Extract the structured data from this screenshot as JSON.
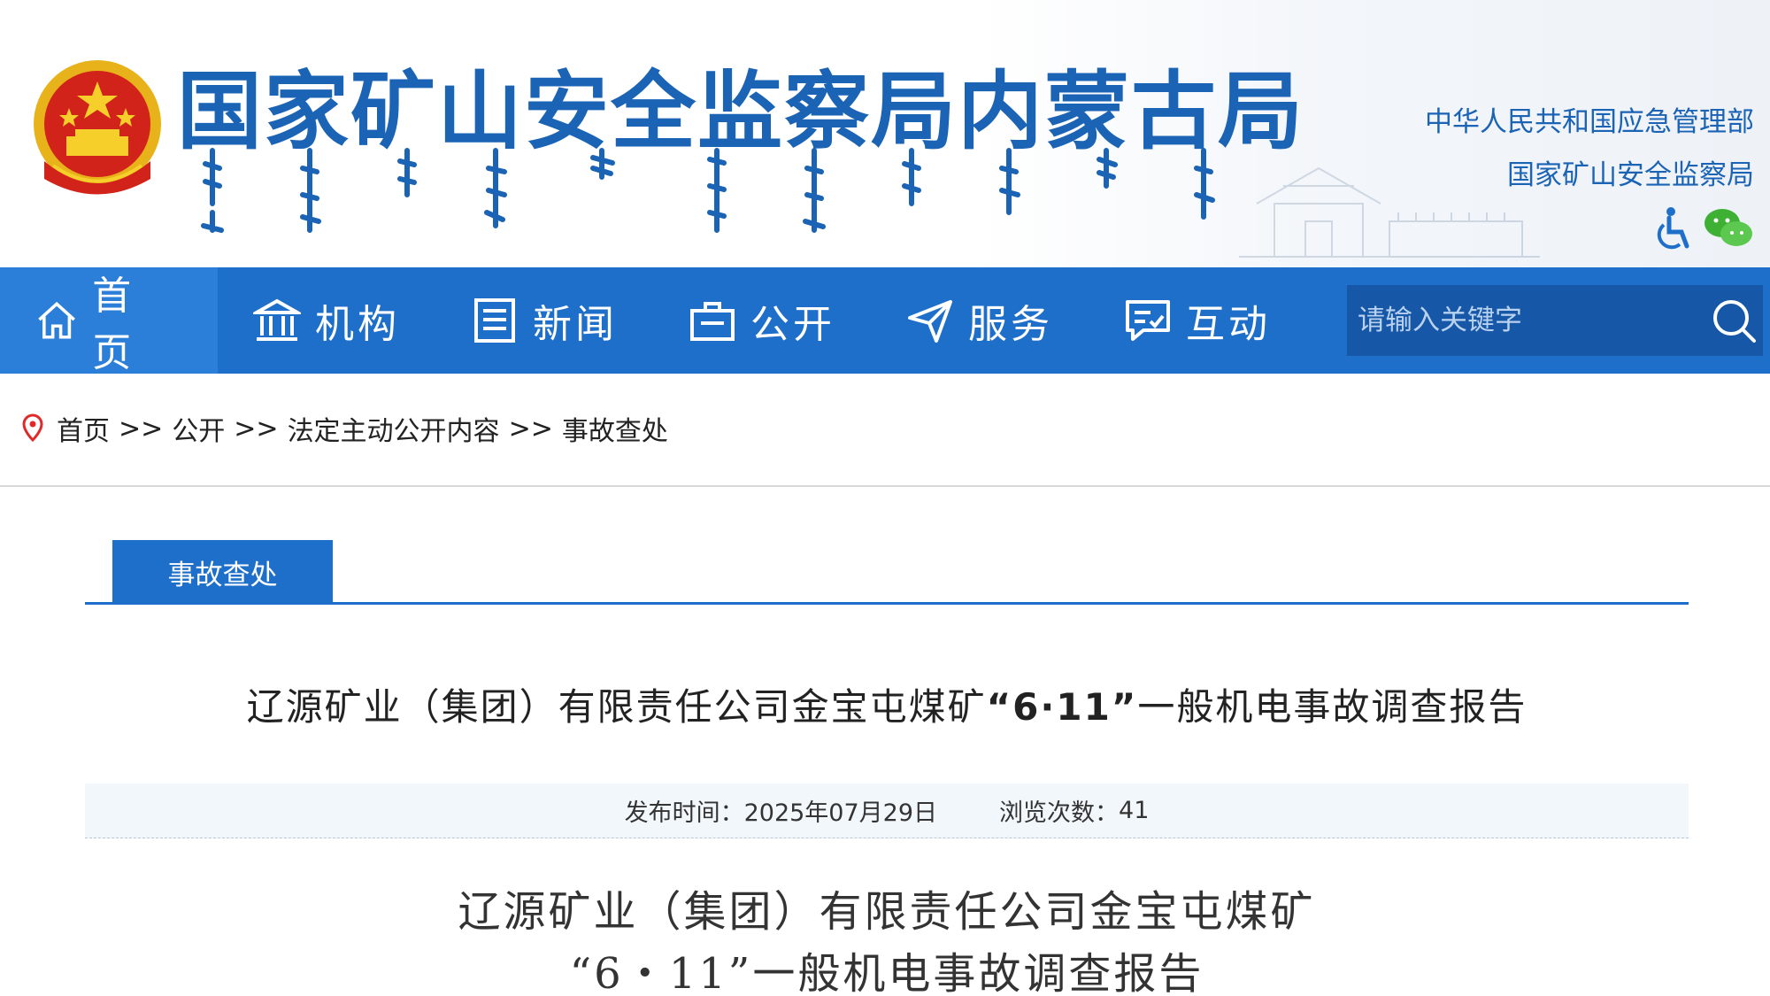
{
  "header": {
    "site_title": "国家矿山安全监察局内蒙古局",
    "parent_links": [
      "中华人民共和国应急管理部",
      "国家矿山安全监察局"
    ],
    "accent_color": "#1e6fc9",
    "title_color": "#1a63b5"
  },
  "nav": {
    "items": [
      {
        "label": "首 页",
        "icon": "home-icon"
      },
      {
        "label": "机构",
        "icon": "institution-icon"
      },
      {
        "label": "新闻",
        "icon": "news-icon"
      },
      {
        "label": "公开",
        "icon": "briefcase-icon"
      },
      {
        "label": "服务",
        "icon": "send-icon"
      },
      {
        "label": "互动",
        "icon": "chat-icon"
      }
    ],
    "search_placeholder": "请输入关键字"
  },
  "breadcrumb": {
    "items": [
      "首页",
      "公开",
      "法定主动公开内容",
      "事故查处"
    ],
    "separator": ">>"
  },
  "section": {
    "tab_label": "事故查处"
  },
  "article": {
    "title_prefix": "辽源矿业（集团）有限责任公司金宝屯煤矿",
    "title_bold": "“6·11”",
    "title_suffix": "一般机电事故调查报告",
    "publish_label": "发布时间：",
    "publish_date": "2025年07月29日",
    "views_label": "浏览次数：",
    "views_count": "41",
    "body_heading_line1": "辽源矿业（集团）有限责任公司金宝屯煤矿",
    "body_heading_line2": "“6・11”一般机电事故调查报告"
  }
}
